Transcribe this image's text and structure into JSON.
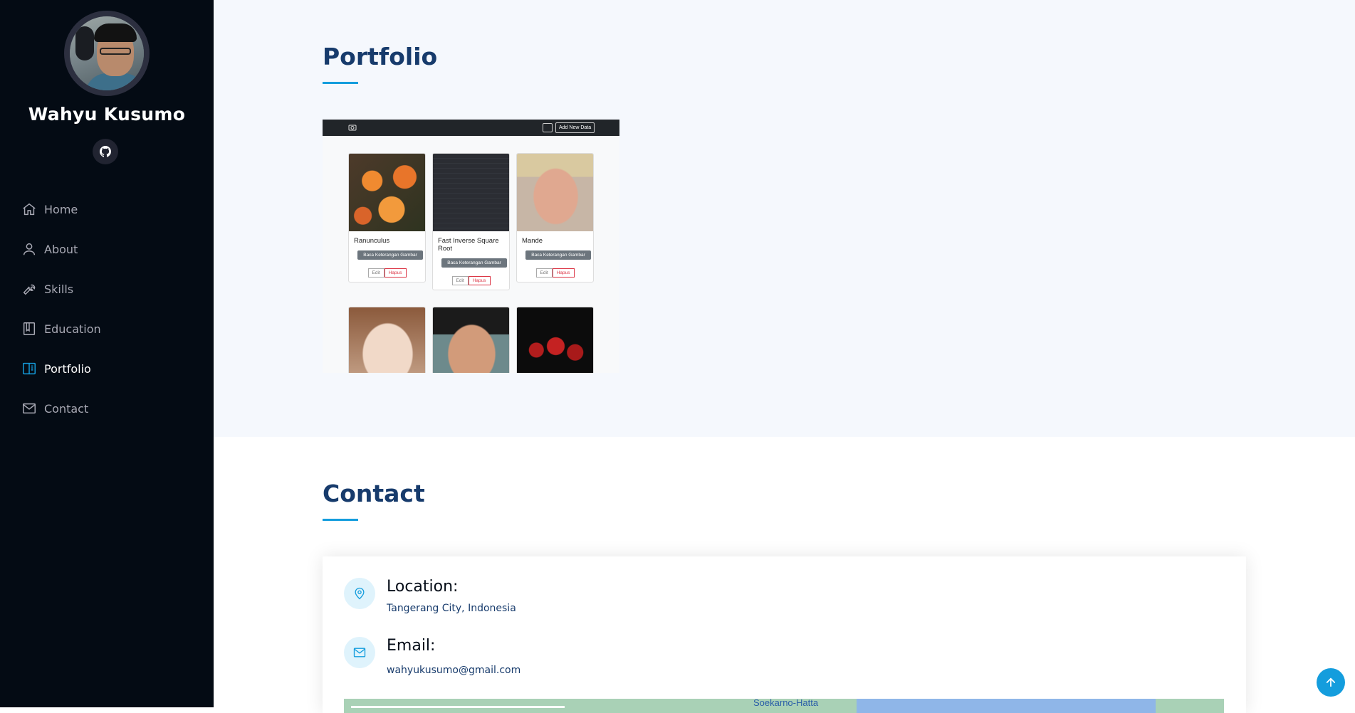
{
  "sidebar": {
    "name": "Wahyu Kusumo",
    "nav": [
      {
        "label": "Home",
        "icon": "house-icon"
      },
      {
        "label": "About",
        "icon": "person-icon"
      },
      {
        "label": "Skills",
        "icon": "wrench-icon"
      },
      {
        "label": "Education",
        "icon": "book-icon"
      },
      {
        "label": "Portfolio",
        "icon": "book-half-icon",
        "active": true
      },
      {
        "label": "Contact",
        "icon": "envelope-icon"
      }
    ]
  },
  "portfolio": {
    "title": "Portfolio",
    "screenshot": {
      "add_button": "Add New Data",
      "cards": [
        {
          "caption": "Ranunculus",
          "button": "Baca Keterangan Gambar",
          "edit": "Edit",
          "delete": "Hapus"
        },
        {
          "caption": "Fast Inverse Square Root",
          "button": "Baca Keterangan Gambar",
          "edit": "Edit",
          "delete": "Hapus"
        },
        {
          "caption": "Mande",
          "button": "Baca Keterangan Gambar",
          "edit": "Edit",
          "delete": "Hapus"
        }
      ]
    }
  },
  "contact": {
    "title": "Contact",
    "location_label": "Location:",
    "location_value": "Tangerang City, Indonesia",
    "email_label": "Email:",
    "email_value": "wahyukusumo@gmail.com",
    "map_label": "Soekarno-Hatta"
  },
  "colors": {
    "accent": "#149ddd",
    "sidebar_bg": "#040b14",
    "heading": "#173b6c",
    "section_bg": "#f5f8fd"
  }
}
